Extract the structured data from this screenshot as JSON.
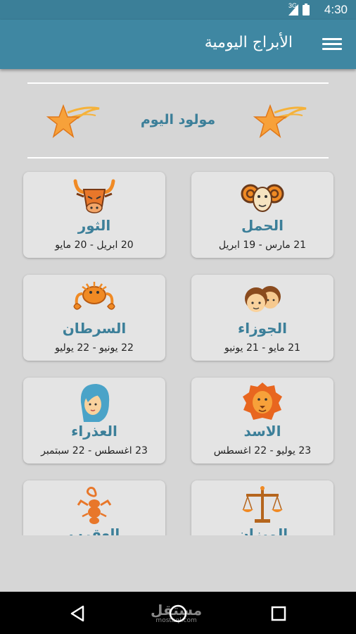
{
  "status_bar": {
    "time": "4:30",
    "network": "3G"
  },
  "toolbar": {
    "title": "الأبراج اليومية"
  },
  "banner": {
    "label": "مولود اليوم"
  },
  "signs": [
    {
      "name": "الحمل",
      "dates": "21 مارس - 19 ابريل",
      "icon": "ram-icon"
    },
    {
      "name": "الثور",
      "dates": "20 ابريل - 20 مايو",
      "icon": "bull-icon"
    },
    {
      "name": "الجوزاء",
      "dates": "21 مايو - 21 يونيو",
      "icon": "twins-icon"
    },
    {
      "name": "السرطان",
      "dates": "22 يونيو - 22 يوليو",
      "icon": "crab-icon"
    },
    {
      "name": "الاسد",
      "dates": "23 يوليو - 22 اغسطس",
      "icon": "lion-icon"
    },
    {
      "name": "العذراء",
      "dates": "23 اغسطس - 22 سبتمبر",
      "icon": "virgo-icon"
    },
    {
      "name": "الميزان",
      "dates": "",
      "icon": "scales-icon"
    },
    {
      "name": "العقرب",
      "dates": "",
      "icon": "scorpion-icon"
    }
  ],
  "watermark": {
    "text": "مستقل",
    "sub": "mostaql.com"
  },
  "colors": {
    "toolbar": "#3f87a2",
    "accent_text": "#3c7f99",
    "background": "#d6d6d6",
    "card": "#e4e4e4",
    "icon_orange": "#f08a24"
  }
}
